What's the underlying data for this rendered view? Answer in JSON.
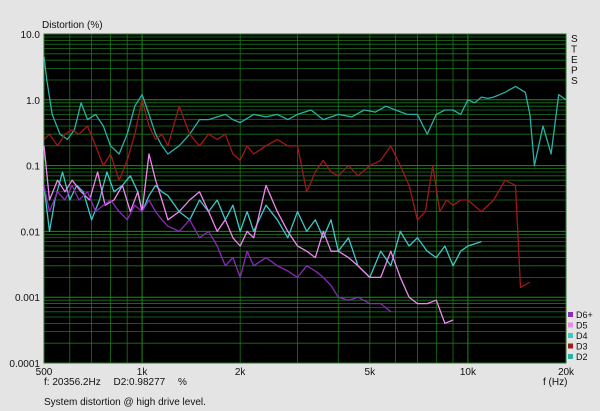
{
  "chart_data": {
    "type": "line",
    "ylabel": "Distortion (%)",
    "xlabel": "f (Hz)",
    "x_scale": "log",
    "y_scale": "log",
    "xlim": [
      500,
      20000
    ],
    "ylim": [
      0.0001,
      10
    ],
    "x_ticks": [
      {
        "value": 500,
        "label": "500"
      },
      {
        "value": 1000,
        "label": "1k"
      },
      {
        "value": 2000,
        "label": "2k"
      },
      {
        "value": 5000,
        "label": "5k"
      },
      {
        "value": 10000,
        "label": "10k"
      },
      {
        "value": 20000,
        "label": "20k"
      }
    ],
    "y_ticks": [
      {
        "value": 10,
        "label": "10.0"
      },
      {
        "value": 1,
        "label": "1.0"
      },
      {
        "value": 0.1,
        "label": "0.1"
      },
      {
        "value": 0.01,
        "label": "0.01"
      },
      {
        "value": 0.001,
        "label": "0.001"
      },
      {
        "value": 0.0001,
        "label": "0.0001"
      }
    ],
    "grid": true,
    "legend_position": "bottom-right",
    "background": "#000000",
    "grid_color": "#1f8a1f",
    "series": [
      {
        "name": "D2",
        "color": "#2ab0a8",
        "x": [
          500,
          510,
          530,
          560,
          590,
          620,
          650,
          680,
          720,
          760,
          800,
          850,
          900,
          950,
          1000,
          1050,
          1100,
          1150,
          1200,
          1300,
          1400,
          1500,
          1600,
          1700,
          1800,
          1900,
          2000,
          2200,
          2400,
          2600,
          2800,
          3000,
          3300,
          3600,
          4000,
          4400,
          4800,
          5200,
          5600,
          6000,
          6500,
          7000,
          7500,
          8000,
          8500,
          9000,
          9500,
          10000,
          10500,
          11000,
          11500,
          12000,
          13000,
          14000,
          15000,
          15500,
          16000,
          17000,
          18000,
          19000,
          20000
        ],
        "y": [
          4.5,
          2.0,
          0.6,
          0.3,
          0.25,
          0.35,
          0.9,
          0.5,
          0.6,
          0.4,
          0.2,
          0.15,
          0.3,
          0.8,
          1.2,
          0.6,
          0.3,
          0.2,
          0.15,
          0.2,
          0.3,
          0.5,
          0.5,
          0.55,
          0.6,
          0.5,
          0.45,
          0.6,
          0.55,
          0.6,
          0.5,
          0.6,
          0.7,
          0.5,
          0.6,
          0.55,
          0.7,
          0.65,
          0.8,
          0.7,
          0.6,
          0.6,
          0.3,
          0.6,
          0.7,
          0.7,
          0.6,
          1.0,
          0.9,
          1.1,
          1.05,
          1.1,
          1.3,
          1.6,
          1.3,
          0.6,
          0.1,
          0.4,
          0.15,
          1.2,
          1.0
        ]
      },
      {
        "name": "D3",
        "color": "#a01818",
        "x": [
          500,
          520,
          550,
          580,
          610,
          640,
          680,
          720,
          760,
          800,
          850,
          900,
          950,
          1000,
          1050,
          1100,
          1150,
          1200,
          1300,
          1400,
          1500,
          1600,
          1700,
          1800,
          1900,
          2000,
          2100,
          2200,
          2400,
          2600,
          2800,
          3000,
          3200,
          3400,
          3600,
          3800,
          4000,
          4300,
          4600,
          5000,
          5400,
          5800,
          6200,
          6600,
          7000,
          7400,
          7800,
          8200,
          8600,
          9000,
          9500,
          10000,
          11000,
          12000,
          13000,
          14000,
          14500,
          15500
        ],
        "y": [
          0.25,
          0.3,
          0.2,
          0.3,
          0.35,
          0.3,
          0.4,
          0.2,
          0.1,
          0.15,
          0.06,
          0.12,
          0.3,
          1.0,
          0.4,
          0.25,
          0.3,
          0.2,
          0.8,
          0.3,
          0.2,
          0.3,
          0.25,
          0.3,
          0.15,
          0.12,
          0.2,
          0.15,
          0.2,
          0.25,
          0.2,
          0.2,
          0.04,
          0.08,
          0.12,
          0.08,
          0.07,
          0.1,
          0.07,
          0.1,
          0.12,
          0.2,
          0.1,
          0.05,
          0.015,
          0.02,
          0.1,
          0.02,
          0.03,
          0.025,
          0.03,
          0.03,
          0.02,
          0.03,
          0.06,
          0.05,
          0.0014,
          0.0017
        ]
      },
      {
        "name": "D4",
        "color": "#3cc8c8",
        "x": [
          500,
          520,
          540,
          570,
          600,
          630,
          660,
          700,
          740,
          780,
          820,
          870,
          920,
          970,
          1000,
          1050,
          1100,
          1150,
          1200,
          1300,
          1400,
          1500,
          1600,
          1700,
          1800,
          1900,
          2000,
          2100,
          2200,
          2400,
          2600,
          2800,
          3000,
          3200,
          3400,
          3600,
          3800,
          4000,
          4300,
          4600,
          5000,
          5400,
          5800,
          6200,
          6600,
          7000,
          7500,
          8000,
          8500,
          9000,
          9500,
          10000,
          11000
        ],
        "y": [
          0.05,
          0.01,
          0.03,
          0.08,
          0.03,
          0.05,
          0.04,
          0.015,
          0.03,
          0.08,
          0.04,
          0.05,
          0.07,
          0.04,
          0.02,
          0.035,
          0.05,
          0.04,
          0.035,
          0.02,
          0.015,
          0.03,
          0.02,
          0.03,
          0.015,
          0.025,
          0.01,
          0.02,
          0.01,
          0.025,
          0.015,
          0.008,
          0.02,
          0.01,
          0.015,
          0.008,
          0.015,
          0.005,
          0.008,
          0.003,
          0.002,
          0.005,
          0.003,
          0.01,
          0.006,
          0.008,
          0.005,
          0.004,
          0.006,
          0.003,
          0.005,
          0.006,
          0.007
        ]
      },
      {
        "name": "D5",
        "color": "#ee88ee",
        "x": [
          500,
          520,
          550,
          580,
          610,
          650,
          690,
          730,
          770,
          820,
          870,
          920,
          970,
          1000,
          1050,
          1100,
          1150,
          1200,
          1300,
          1400,
          1500,
          1600,
          1700,
          1800,
          1900,
          2000,
          2100,
          2200,
          2400,
          2600,
          2800,
          3000,
          3200,
          3400,
          3600,
          3800,
          4000,
          4300,
          4600,
          5000,
          5400,
          5800,
          6200,
          6600,
          7000,
          7500,
          8000,
          8500,
          9000
        ],
        "y": [
          0.2,
          0.03,
          0.06,
          0.04,
          0.06,
          0.04,
          0.03,
          0.08,
          0.025,
          0.03,
          0.05,
          0.02,
          0.04,
          0.02,
          0.15,
          0.06,
          0.03,
          0.015,
          0.02,
          0.03,
          0.04,
          0.02,
          0.01,
          0.015,
          0.008,
          0.006,
          0.01,
          0.008,
          0.05,
          0.02,
          0.01,
          0.006,
          0.005,
          0.004,
          0.01,
          0.005,
          0.005,
          0.004,
          0.003,
          0.002,
          0.002,
          0.005,
          0.002,
          0.001,
          0.0008,
          0.0008,
          0.0009,
          0.0004,
          0.00045
        ]
      },
      {
        "name": "D6+",
        "color": "#8a2ab8",
        "x": [
          500,
          520,
          550,
          580,
          610,
          640,
          680,
          720,
          760,
          800,
          850,
          900,
          950,
          1000,
          1050,
          1100,
          1150,
          1200,
          1300,
          1400,
          1500,
          1600,
          1700,
          1800,
          1900,
          2000,
          2100,
          2200,
          2400,
          2600,
          2800,
          3000,
          3200,
          3400,
          3600,
          3800,
          4000,
          4300,
          4600,
          5000,
          5400,
          5800
        ],
        "y": [
          0.05,
          0.02,
          0.04,
          0.03,
          0.05,
          0.03,
          0.04,
          0.02,
          0.025,
          0.03,
          0.02,
          0.015,
          0.025,
          0.02,
          0.03,
          0.02,
          0.015,
          0.012,
          0.01,
          0.015,
          0.008,
          0.01,
          0.006,
          0.003,
          0.004,
          0.002,
          0.005,
          0.003,
          0.004,
          0.003,
          0.0025,
          0.002,
          0.003,
          0.0025,
          0.002,
          0.0015,
          0.001,
          0.0009,
          0.001,
          0.0008,
          0.0008,
          0.0006
        ]
      }
    ]
  },
  "side_label": [
    "S",
    "T",
    "E",
    "P",
    "S"
  ],
  "status": {
    "freq": "f: 20356.2Hz",
    "d2": "D2:0.98277",
    "unit": "%"
  },
  "caption": "System distortion @ high drive level."
}
